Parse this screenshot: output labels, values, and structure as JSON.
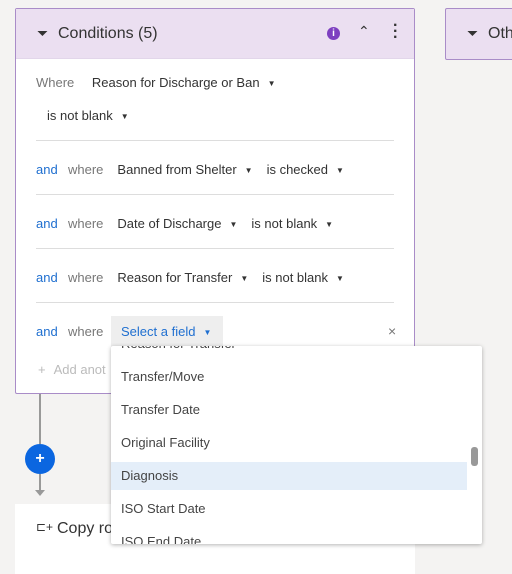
{
  "conditions": {
    "title": "Conditions (5)",
    "first": {
      "where_label": "Where",
      "field": "Reason for Discharge or Ban",
      "operator": "is not blank"
    },
    "rows": [
      {
        "and": "and",
        "where": "where",
        "field": "Banned from Shelter",
        "operator": "is checked"
      },
      {
        "and": "and",
        "where": "where",
        "field": "Date of Discharge",
        "operator": "is not blank"
      },
      {
        "and": "and",
        "where": "where",
        "field": "Reason for Transfer",
        "operator": "is not blank"
      }
    ],
    "new_row": {
      "and": "and",
      "where": "where",
      "field_placeholder": "Select a field"
    },
    "add_another": "Add anot"
  },
  "other_card": {
    "title": "Oth"
  },
  "copy_card": {
    "title": "Copy ro"
  },
  "dropdown": {
    "items": [
      "Reason for Transfer",
      "Transfer/Move",
      "Transfer Date",
      "Original Facility",
      "Diagnosis",
      "ISO Start Date",
      "ISO End Date"
    ],
    "highlighted": "Diagnosis"
  },
  "colors": {
    "accent": "#1f6fd0",
    "header": "#ebdff1",
    "info": "#7d3fc0"
  }
}
